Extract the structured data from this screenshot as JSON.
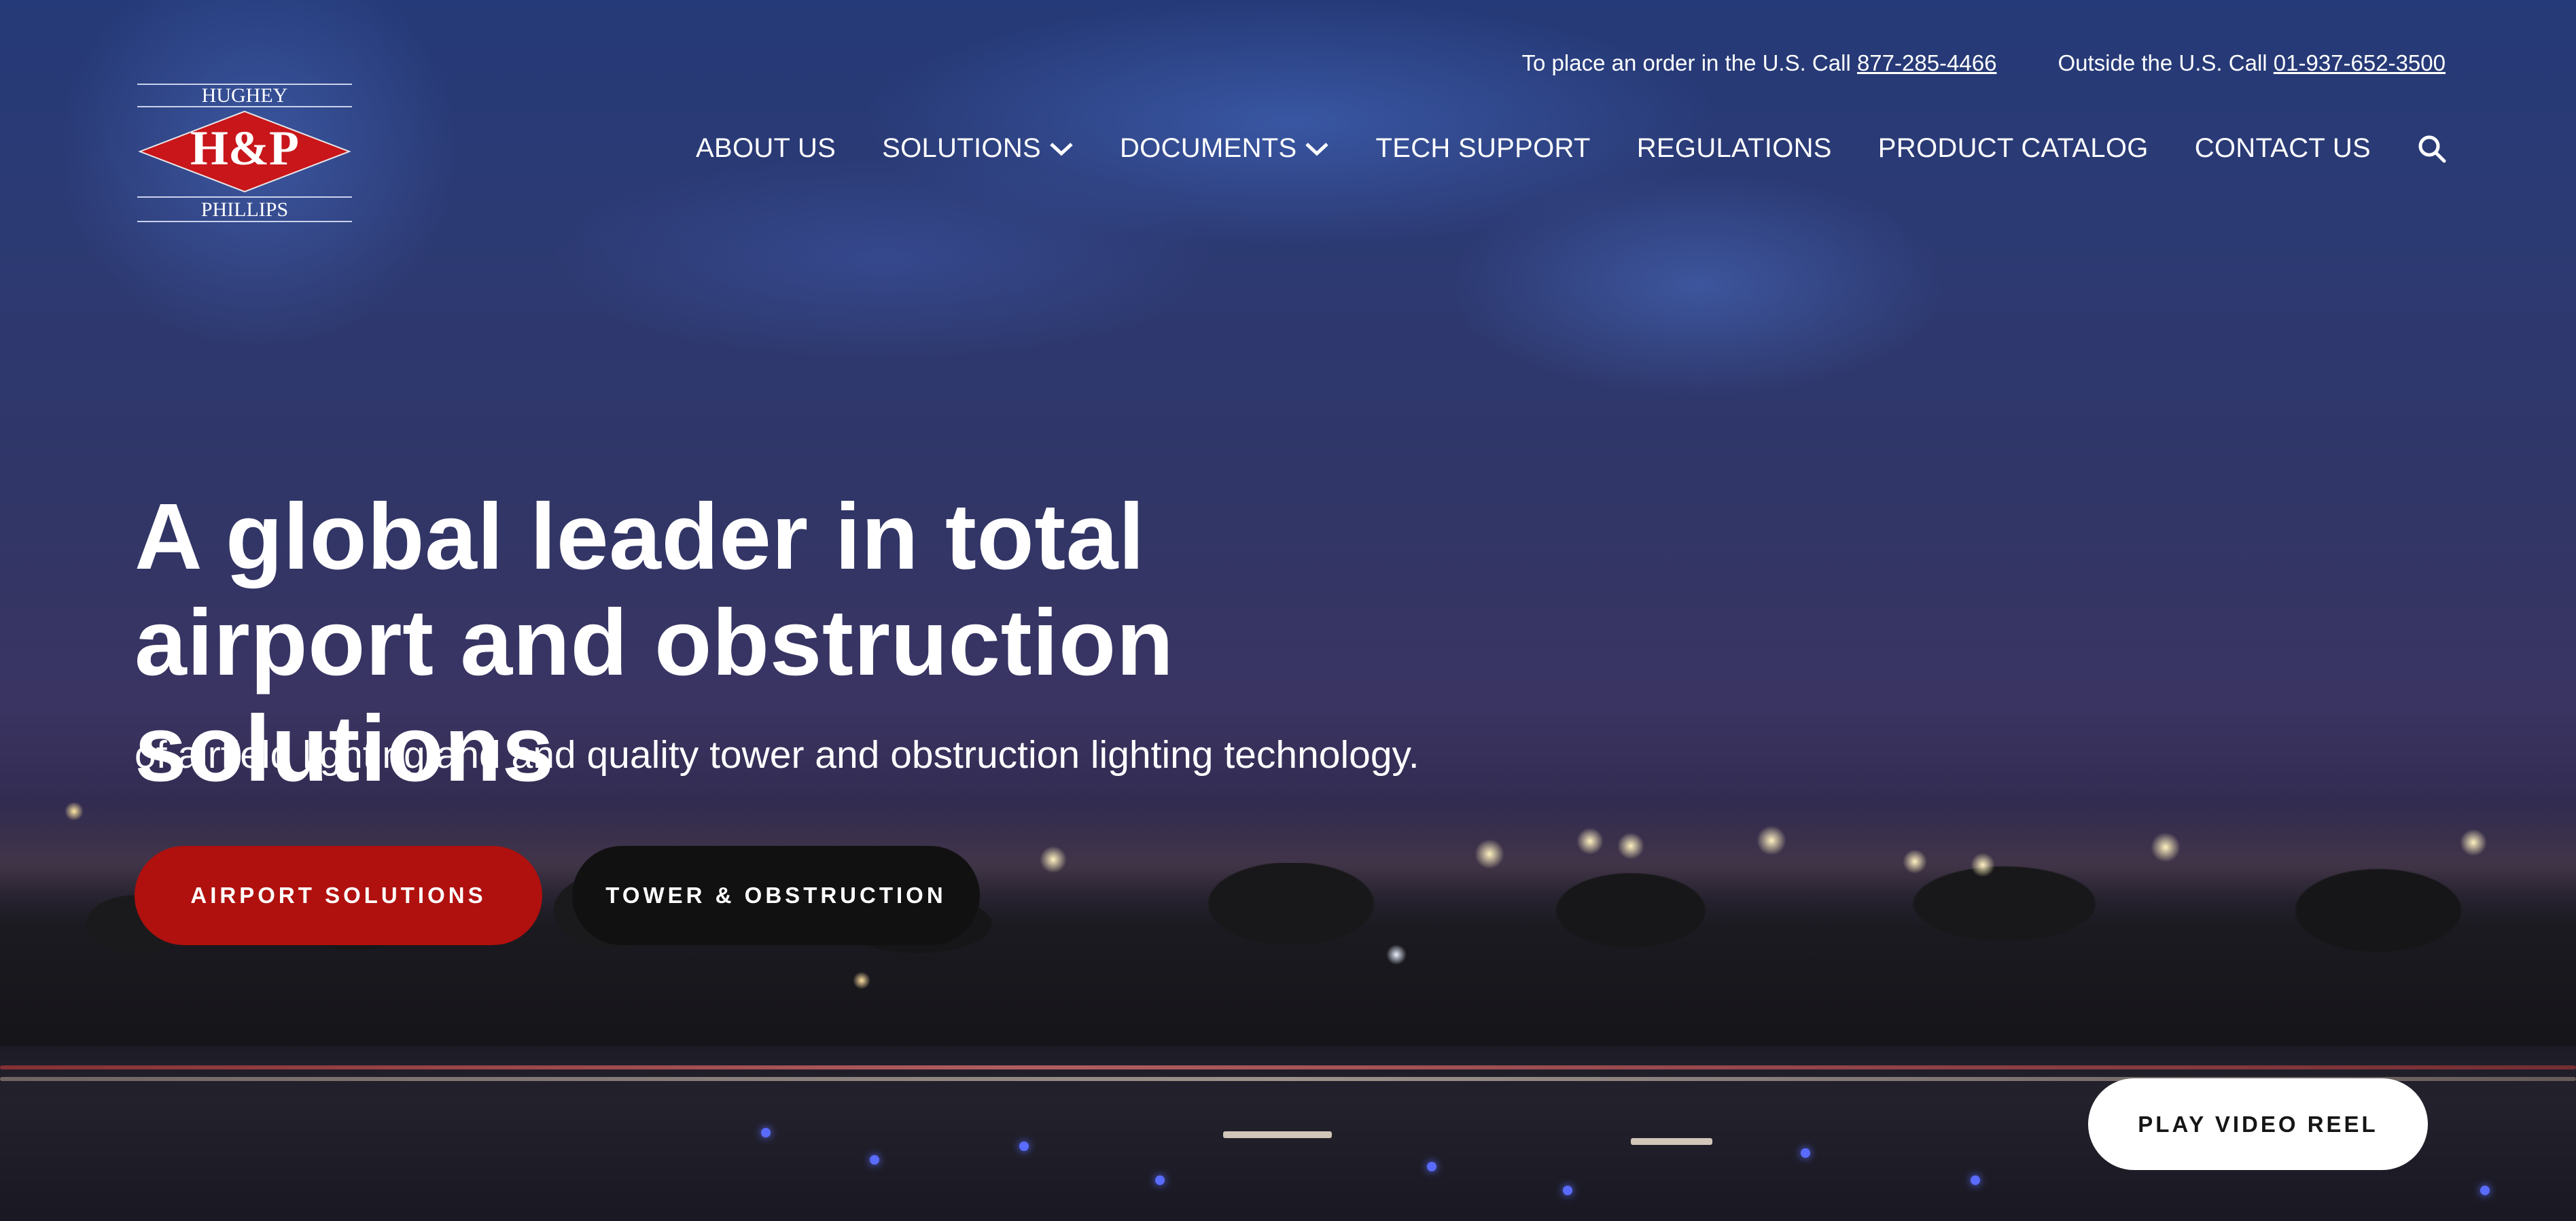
{
  "topbar": {
    "us_prefix": "To place an order in the U.S. Call ",
    "us_phone": "877-285-4466",
    "intl_prefix": "Outside the U.S. Call ",
    "intl_phone": "01-937-652-3500"
  },
  "logo": {
    "top_text": "HUGHEY",
    "mark": "H&P",
    "bottom_text": "PHILLIPS",
    "color": "#c8161b"
  },
  "nav": {
    "items": [
      {
        "label": "ABOUT US"
      },
      {
        "label": "SOLUTIONS",
        "icon": "chevron-down-icon"
      },
      {
        "label": "DOCUMENTS",
        "icon": "chevron-down-icon"
      },
      {
        "label": "TECH SUPPORT"
      },
      {
        "label": "REGULATIONS"
      },
      {
        "label": "PRODUCT CATALOG"
      },
      {
        "label": "CONTACT US"
      }
    ],
    "search_icon": "search-icon"
  },
  "hero": {
    "headline": "A global leader in total airport and obstruction solutions",
    "subheadline": "of airfield lighting and and quality tower and obstruction lighting technology.",
    "primary_button": "AIRPORT SOLUTIONS",
    "secondary_button": "TOWER & OBSTRUCTION",
    "video_button": "PLAY VIDEO REEL"
  },
  "colors": {
    "accent_red": "#b0100e",
    "button_dark": "#111111",
    "button_light": "#ffffff"
  }
}
